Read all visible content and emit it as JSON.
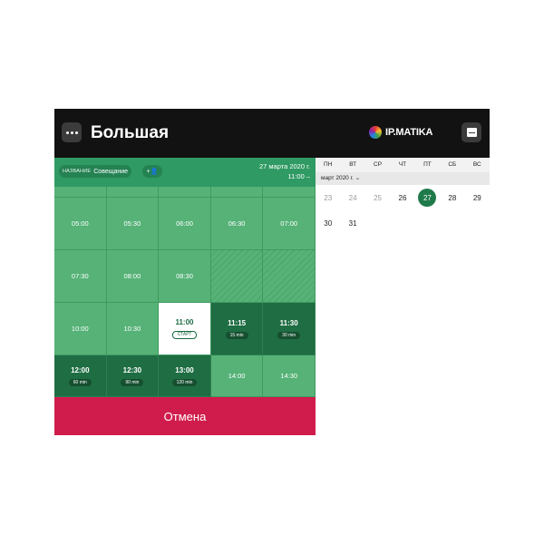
{
  "header": {
    "room_title": "Большая",
    "brand": "IP.MATIKA"
  },
  "booking": {
    "name_label": "НАЗВАНИЕ",
    "name_value": "Совещание",
    "add_participant_icon": "+👤",
    "date": "27 марта 2020 г.",
    "time_range": "11:00 –"
  },
  "slots": [
    {
      "time": "",
      "state": "stub"
    },
    {
      "time": "",
      "state": "stub"
    },
    {
      "time": "",
      "state": "stub"
    },
    {
      "time": "",
      "state": "stub"
    },
    {
      "time": "",
      "state": "stub"
    },
    {
      "time": "05:00",
      "state": "free"
    },
    {
      "time": "05:30",
      "state": "free"
    },
    {
      "time": "06:00",
      "state": "free"
    },
    {
      "time": "06:30",
      "state": "free"
    },
    {
      "time": "07:00",
      "state": "free"
    },
    {
      "time": "07:30",
      "state": "free"
    },
    {
      "time": "08:00",
      "state": "free"
    },
    {
      "time": "08:30",
      "state": "free"
    },
    {
      "time": "",
      "state": "hatch"
    },
    {
      "time": "",
      "state": "hatch"
    },
    {
      "time": "10:00",
      "state": "free"
    },
    {
      "time": "10:30",
      "state": "free"
    },
    {
      "time": "11:00",
      "state": "start",
      "tag": "СТАРТ"
    },
    {
      "time": "11:15",
      "state": "duration",
      "tag": "15 min"
    },
    {
      "time": "11:30",
      "state": "duration",
      "tag": "30 min"
    },
    {
      "time": "12:00",
      "state": "duration",
      "tag": "60 min"
    },
    {
      "time": "12:30",
      "state": "duration",
      "tag": "90 min"
    },
    {
      "time": "13:00",
      "state": "duration",
      "tag": "120 min"
    },
    {
      "time": "14:00",
      "state": "free"
    },
    {
      "time": "14:30",
      "state": "free"
    }
  ],
  "cancel_label": "Отмена",
  "calendar": {
    "weekdays": [
      "ПН",
      "ВТ",
      "СР",
      "ЧТ",
      "ПТ",
      "СБ",
      "ВС"
    ],
    "month_label": "март 2020 г. ⌄",
    "days": [
      {
        "n": "23",
        "state": "muted"
      },
      {
        "n": "24",
        "state": "muted"
      },
      {
        "n": "25",
        "state": "muted"
      },
      {
        "n": "26",
        "state": "normal"
      },
      {
        "n": "27",
        "state": "selected"
      },
      {
        "n": "28",
        "state": "normal"
      },
      {
        "n": "29",
        "state": "normal"
      },
      {
        "n": "30",
        "state": "normal"
      },
      {
        "n": "31",
        "state": "normal"
      }
    ]
  },
  "colors": {
    "accent_green": "#56b277",
    "dark_green": "#1f6d43",
    "cancel_red": "#d01c4c",
    "header_black": "#121212"
  }
}
